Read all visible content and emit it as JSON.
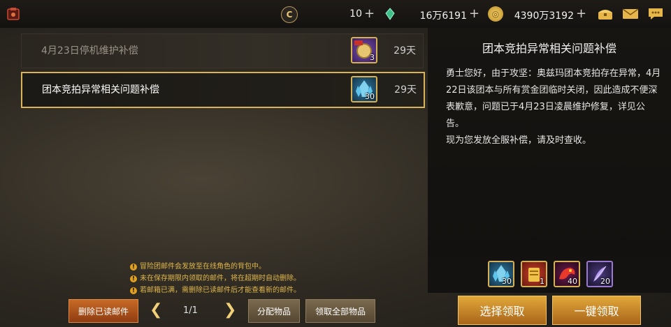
{
  "topbar": {
    "currencies": [
      {
        "icon": "coin-c-icon",
        "value": "10"
      },
      {
        "icon": "green-gem-icon",
        "value": "16万6191"
      },
      {
        "icon": "gold-coin-icon",
        "value": "4390万3192"
      }
    ],
    "plus_label": "+"
  },
  "mails": [
    {
      "title": "4月23日停机维护补偿",
      "days": "29天",
      "item_count": "3",
      "item_icon": "gold-medal-icon",
      "selected": false
    },
    {
      "title": "团本竞拍异常相关问题补偿",
      "days": "29天",
      "item_count": "30",
      "item_icon": "crystal-icon",
      "selected": true
    }
  ],
  "detail": {
    "title": "团本竞拍异常相关问题补偿",
    "body": [
      "勇士您好，由于攻坚：奥兹玛团本竞拍存在异常，4月22日该团本与所有赏金团临时关闭，因此造成不便深表歉意，问题已于4月23日凌晨维护修复，详见公告。",
      "现为您发放全服补偿，请及时查收。"
    ]
  },
  "rewards": [
    {
      "icon": "crystal-icon",
      "count": "30"
    },
    {
      "icon": "gold-scroll-icon",
      "count": "1"
    },
    {
      "icon": "red-dragon-icon",
      "count": "40"
    },
    {
      "icon": "purple-feather-icon",
      "count": "20"
    }
  ],
  "notices": [
    "冒险团邮件会发放至在线角色的背包中。",
    "未在保存期限内领取的邮件，将在超期时自动删除。",
    "若邮箱已满，需删除已读邮件后才能查看新的邮件。"
  ],
  "footer": {
    "delete_read": "删除已读邮件",
    "page": "1/1",
    "distribute": "分配物品",
    "claim_all_items": "领取全部物品",
    "select_claim": "选择领取",
    "one_click_claim": "一键领取"
  },
  "colors": {
    "accent_gold": "#d9b35a",
    "notice": "#e0b64c",
    "button_orange": "#c76a26"
  }
}
